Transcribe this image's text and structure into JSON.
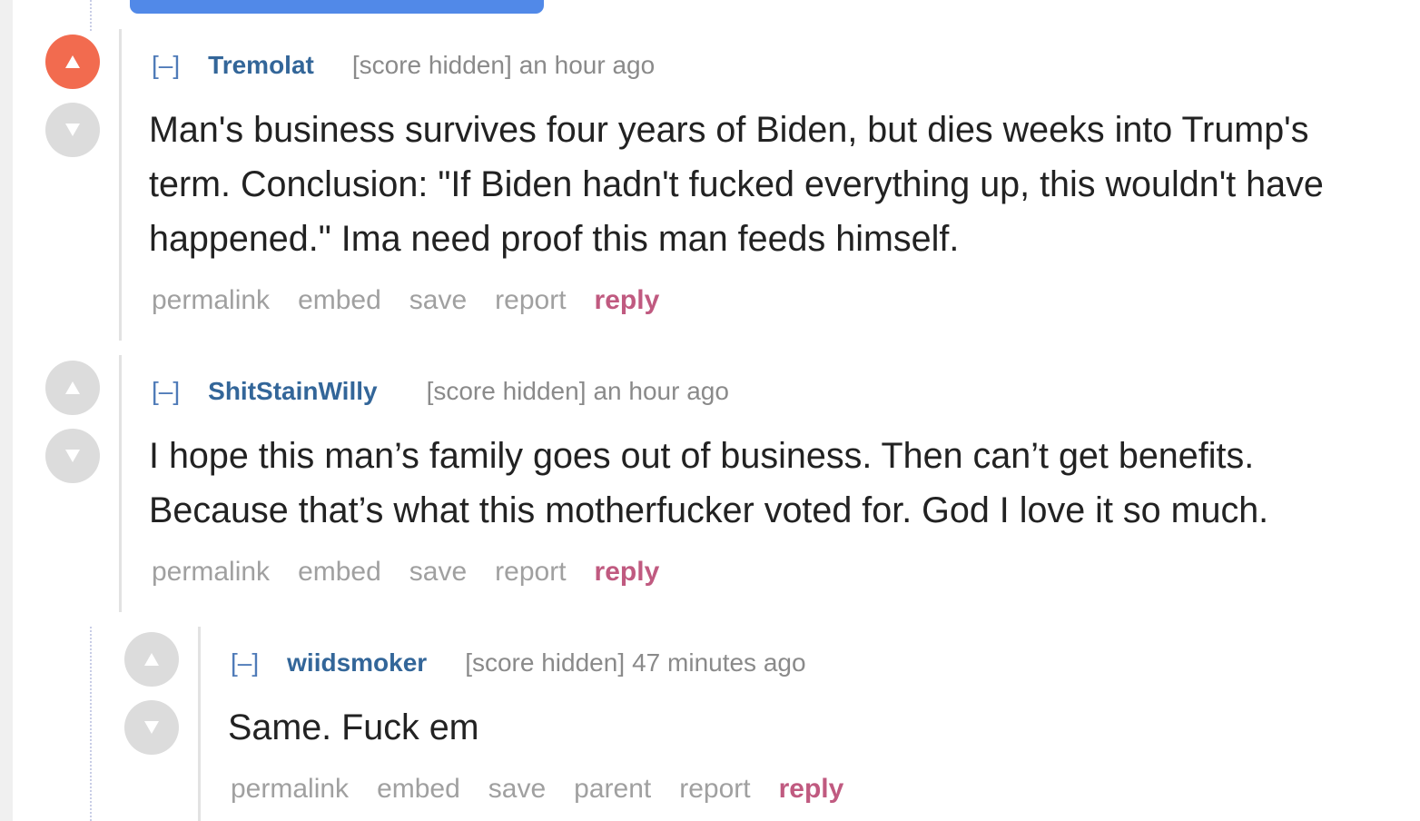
{
  "comments": [
    {
      "collapse": "[–]",
      "author": "Tremolat",
      "score": "[score hidden]",
      "time": "an hour ago",
      "body_lines": [
        "Man's business survives four years of Biden, but dies weeks into Trump's",
        "term. Conclusion: \"If Biden hadn't fucked everything up, this wouldn't have",
        "happened.\" Ima need proof this man feeds himself."
      ],
      "actions": {
        "permalink": "permalink",
        "embed": "embed",
        "save": "save",
        "report": "report",
        "reply": "reply"
      },
      "upvoted": true
    },
    {
      "collapse": "[–]",
      "author": "ShitStainWilly",
      "score": "[score hidden]",
      "time": "an hour ago",
      "body_lines": [
        "I hope this man’s family goes out of business. Then can’t get benefits.",
        "Because that’s what this motherfucker voted for. God I love it so much."
      ],
      "actions": {
        "permalink": "permalink",
        "embed": "embed",
        "save": "save",
        "report": "report",
        "reply": "reply"
      },
      "upvoted": false
    },
    {
      "collapse": "[–]",
      "author": "wiidsmoker",
      "score": "[score hidden]",
      "time": "47 minutes ago",
      "body_lines": [
        "Same. Fuck em"
      ],
      "actions": {
        "permalink": "permalink",
        "embed": "embed",
        "save": "save",
        "parent": "parent",
        "report": "report",
        "reply": "reply"
      },
      "upvoted": false
    }
  ],
  "icons": {
    "upvote": "up-arrow-icon",
    "downvote": "down-arrow-icon"
  },
  "colors": {
    "upvote_active": "#f26b4f",
    "vote_inactive": "#dcdcdc",
    "author": "#336699",
    "reply": "#c05a80",
    "button": "#5189e8"
  }
}
